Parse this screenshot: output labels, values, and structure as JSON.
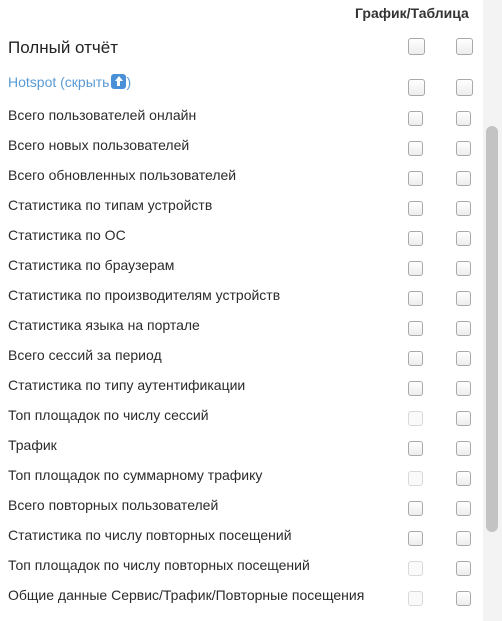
{
  "header": {
    "columns_label": "График/Таблица"
  },
  "full_report": {
    "label": "Полный отчёт"
  },
  "hotspot": {
    "label": "Hotspot (скрыть",
    "suffix": ")"
  },
  "rows": [
    {
      "label": "Всего пользователей онлайн",
      "chart_enabled": true
    },
    {
      "label": "Всего новых пользователей",
      "chart_enabled": true
    },
    {
      "label": "Всего обновленных пользователей",
      "chart_enabled": true
    },
    {
      "label": "Статистика по типам устройств",
      "chart_enabled": true
    },
    {
      "label": "Статистика по ОС",
      "chart_enabled": true
    },
    {
      "label": "Статистика по браузерам",
      "chart_enabled": true
    },
    {
      "label": "Статистика по производителям устройств",
      "chart_enabled": true
    },
    {
      "label": "Статистика языка на портале",
      "chart_enabled": true
    },
    {
      "label": "Всего сессий за период",
      "chart_enabled": true
    },
    {
      "label": "Статистика по типу аутентификации",
      "chart_enabled": true
    },
    {
      "label": "Топ площадок по числу сессий",
      "chart_enabled": false
    },
    {
      "label": "Трафик",
      "chart_enabled": true
    },
    {
      "label": "Топ площадок по суммарному трафику",
      "chart_enabled": false
    },
    {
      "label": "Всего повторных пользователей",
      "chart_enabled": true
    },
    {
      "label": "Статистика по числу повторных посещений",
      "chart_enabled": true
    },
    {
      "label": "Топ площадок по числу повторных посещений",
      "chart_enabled": false
    },
    {
      "label": "Общие данные Сервис/Трафик/Повторные посещения",
      "chart_enabled": false
    }
  ]
}
